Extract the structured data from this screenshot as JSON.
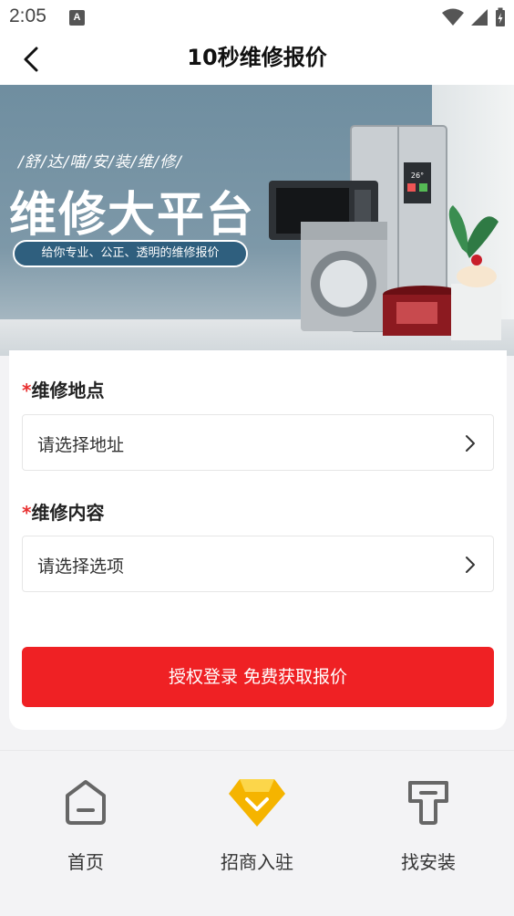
{
  "status_bar": {
    "time": "2:05",
    "notification_badge": "A"
  },
  "nav": {
    "title": "10秒维修报价",
    "back_icon": "chevron-left-icon"
  },
  "banner": {
    "subtitle": "/舒/达/喵/安/装/维/修/",
    "title": "维修大平台",
    "tagline": "给你专业、公正、透明的维修报价",
    "lcd_value": "26°"
  },
  "form": {
    "location": {
      "required_mark": "*",
      "label": "维修地点",
      "value": "请选择地址"
    },
    "content": {
      "required_mark": "*",
      "label": "维修内容",
      "value": "请选择选项"
    },
    "submit_label": "授权登录 免费获取报价"
  },
  "tabs": [
    {
      "label": "首页",
      "icon": "home-icon"
    },
    {
      "label": "招商入驻",
      "icon": "diamond-icon",
      "accent": "#f5b400"
    },
    {
      "label": "找安装",
      "icon": "tool-icon"
    }
  ],
  "colors": {
    "primary_red": "#ef2124",
    "required_red": "#e83030",
    "accent_yellow": "#f5b400"
  }
}
